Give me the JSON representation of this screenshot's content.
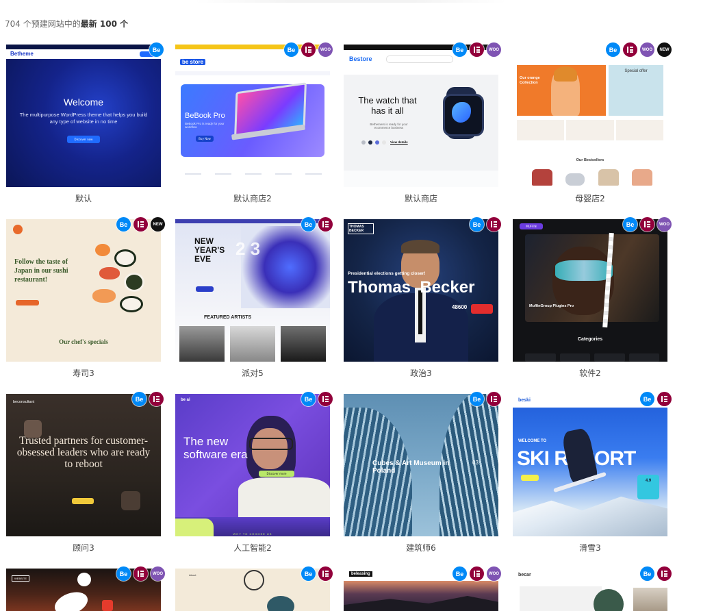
{
  "summary": {
    "prefix": "704 个预建网站中的",
    "highlight": "最新 100 个"
  },
  "badge_labels": {
    "be": "Be",
    "woo": "WOO",
    "new": "NEW"
  },
  "cards": [
    {
      "caption": "默认",
      "badges": [
        "be"
      ],
      "thumb": {
        "logo": "Betheme",
        "headline": "Welcome",
        "sub": "The multipurpose WordPress theme that helps you build any type of website in no time",
        "button": "Discover now"
      }
    },
    {
      "caption": "默认商店2",
      "badges": [
        "be",
        "el",
        "woo"
      ],
      "thumb": {
        "logo": "be store",
        "headline": "BeBook Pro",
        "sub": "BeBook Pro is ready for your workflow",
        "button": "Buy Now"
      }
    },
    {
      "caption": "默认商店",
      "badges": [
        "be",
        "el",
        "woo"
      ],
      "thumb": {
        "logo": "Bestore",
        "headline": "The watch that has it all",
        "sub": "Bethemers is ready for your ecommerce business",
        "button": "View details"
      }
    },
    {
      "caption": "母婴店2",
      "badges": [
        "be",
        "el",
        "woo",
        "new"
      ],
      "thumb": {
        "headline": "Our orange Collection",
        "sub": "Special offer",
        "bottom": "Our Bestsellers"
      }
    },
    {
      "caption": "寿司3",
      "badges": [
        "be",
        "el",
        "new"
      ],
      "thumb": {
        "headline": "Follow the taste of Japan in our sushi restaurant!",
        "bottom": "Our chef's specials"
      }
    },
    {
      "caption": "派对5",
      "badges": [
        "be",
        "el"
      ],
      "thumb": {
        "headline": "NEW YEAR'S EVE",
        "bottom": "FEATURED ARTISTS"
      }
    },
    {
      "caption": "政治3",
      "badges": [
        "be",
        "el"
      ],
      "thumb": {
        "logo": "THOMAS BECKER",
        "tagline": "Presidential elections getting closer!",
        "headline": "Thomas  Becker",
        "number": "48600"
      }
    },
    {
      "caption": "软件2",
      "badges": [
        "be",
        "el",
        "woo"
      ],
      "thumb": {
        "logo": "MUFFIN",
        "headline": "MuffinGroup Plugins Pro",
        "bottom": "Categories"
      }
    },
    {
      "caption": "顾问3",
      "badges": [
        "be",
        "el"
      ],
      "thumb": {
        "logo": "beconsultant",
        "headline": "Trusted partners for customer-obsessed leaders who are ready to reboot"
      }
    },
    {
      "caption": "人工智能2",
      "badges": [
        "be",
        "el"
      ],
      "thumb": {
        "logo": "be ai",
        "headline": "The new software era",
        "button": "Discover more",
        "bottom": "WHY TO CHOOSE US"
      }
    },
    {
      "caption": "建筑师6",
      "badges": [
        "be",
        "el"
      ],
      "thumb": {
        "headline": "Cubes & Art Museum in Poland",
        "number": "03"
      }
    },
    {
      "caption": "滑雪3",
      "badges": [
        "be",
        "el"
      ],
      "thumb": {
        "logo": "beski",
        "tagline": "WELCOME TO",
        "headline": "SKI RESORT",
        "number": "4.9"
      }
    },
    {
      "caption": "",
      "badges": [
        "be",
        "el",
        "woo"
      ],
      "thumb": {
        "logo": "WEBSITE"
      }
    },
    {
      "caption": "",
      "badges": [
        "be",
        "el"
      ],
      "thumb": {
        "logo": "About"
      }
    },
    {
      "caption": "",
      "badges": [
        "be",
        "el",
        "woo"
      ],
      "thumb": {
        "logo": "beleasing"
      }
    },
    {
      "caption": "",
      "badges": [
        "be",
        "el"
      ],
      "thumb": {
        "logo": "becar"
      }
    }
  ]
}
